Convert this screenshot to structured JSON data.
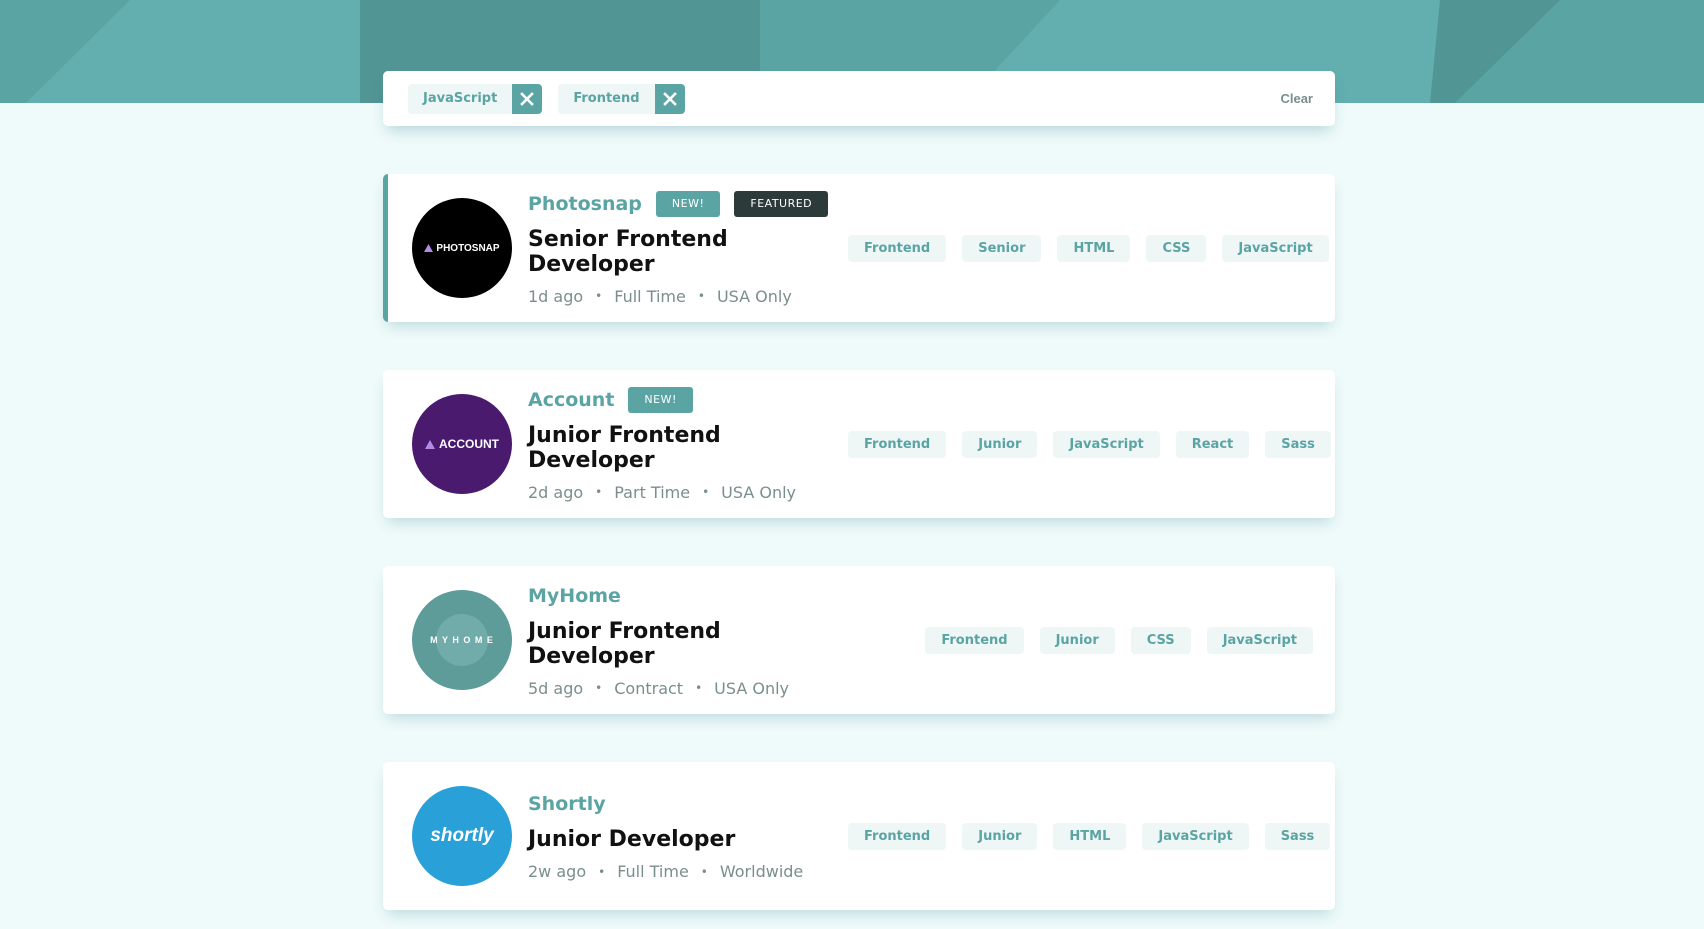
{
  "colors": {
    "primary": "#5ba4a4",
    "background": "#effafa",
    "dark": "#2c3a3a"
  },
  "filters": {
    "active": [
      "JavaScript",
      "Frontend"
    ],
    "clear_label": "Clear"
  },
  "jobs": [
    {
      "company": "Photosnap",
      "logo_text": "PHOTOSNAP",
      "logo_color": "#000000",
      "new_label": "NEW!",
      "featured_label": "FEATURED",
      "position": "Senior Frontend Developer",
      "posted": "1d ago",
      "contract": "Full Time",
      "location": "USA Only",
      "tags": [
        "Frontend",
        "Senior",
        "HTML",
        "CSS",
        "JavaScript"
      ]
    },
    {
      "company": "Account",
      "logo_text": "ACCOUNT",
      "logo_color": "#4a1a6e",
      "new_label": "NEW!",
      "position": "Junior Frontend Developer",
      "posted": "2d ago",
      "contract": "Part Time",
      "location": "USA Only",
      "tags": [
        "Frontend",
        "Junior",
        "JavaScript",
        "React",
        "Sass"
      ]
    },
    {
      "company": "MyHome",
      "logo_text": "M Y H O M E",
      "logo_color": "#5d9c99",
      "position": "Junior Frontend Developer",
      "posted": "5d ago",
      "contract": "Contract",
      "location": "USA Only",
      "tags": [
        "Frontend",
        "Junior",
        "CSS",
        "JavaScript"
      ]
    },
    {
      "company": "Shortly",
      "logo_text": "shortly",
      "logo_color": "#2aa0d8",
      "position": "Junior Developer",
      "posted": "2w ago",
      "contract": "Full Time",
      "location": "Worldwide",
      "tags": [
        "Frontend",
        "Junior",
        "HTML",
        "JavaScript",
        "Sass"
      ]
    }
  ]
}
